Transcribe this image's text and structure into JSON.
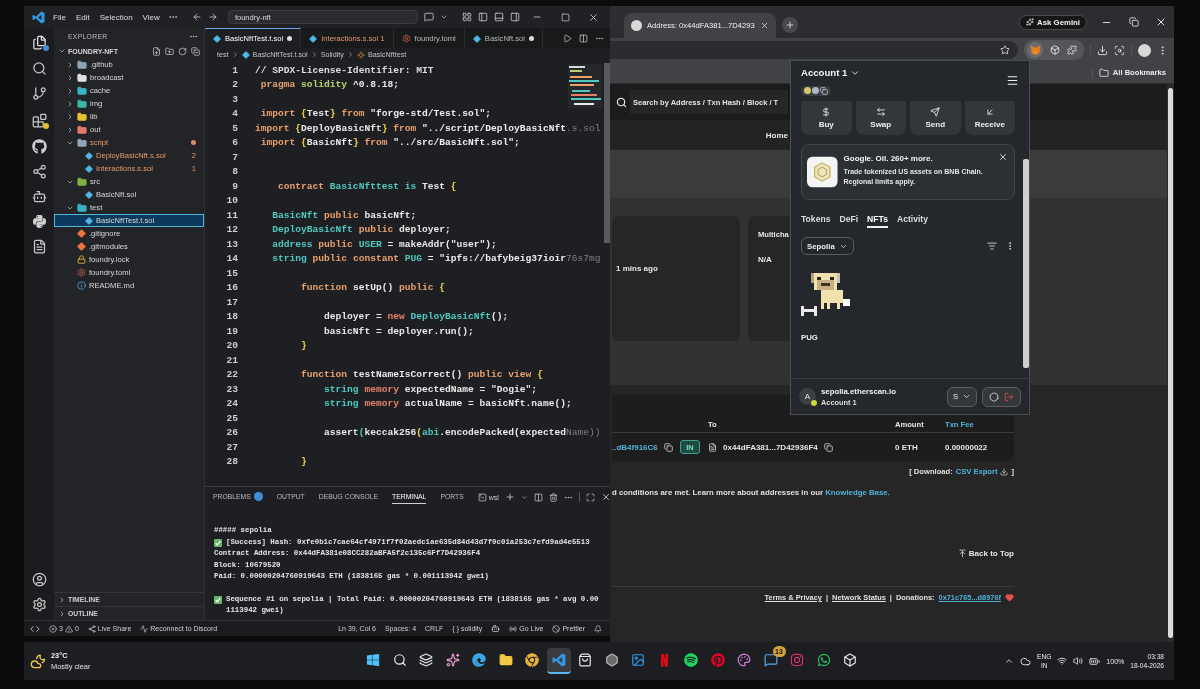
{
  "vscode": {
    "menu": [
      "File",
      "Edit",
      "Selection",
      "View"
    ],
    "command_center": "foundry-nft",
    "explorer_title": "EXPLORER",
    "project": "FOUNDRY-NFT",
    "tree": [
      {
        "name": ".github",
        "kind": "folder",
        "color": "#8fa4b8",
        "expanded": false,
        "selected": false,
        "modified": false
      },
      {
        "name": "broadcast",
        "kind": "folder",
        "color": "#e3e3e3",
        "expanded": false,
        "selected": false,
        "modified": false
      },
      {
        "name": "cache",
        "kind": "folder",
        "color": "#38b2c7",
        "expanded": false,
        "selected": false,
        "modified": false
      },
      {
        "name": "img",
        "kind": "folder",
        "color": "#3bb5a6",
        "expanded": false,
        "selected": false,
        "modified": false
      },
      {
        "name": "lib",
        "kind": "folder",
        "color": "#e8c22d",
        "expanded": false,
        "selected": false,
        "modified": false
      },
      {
        "name": "out",
        "kind": "folder",
        "color": "#e5796b",
        "expanded": false,
        "selected": false,
        "modified": false
      },
      {
        "name": "script",
        "kind": "folder",
        "color": "#8fa4b8",
        "expanded": true,
        "selected": false,
        "modified": true,
        "children": [
          {
            "name": "DeployBasicNft.s.sol",
            "kind": "solidity",
            "selected": false,
            "modified": true,
            "problems": "2"
          },
          {
            "name": "Interactions.s.sol",
            "kind": "solidity",
            "selected": false,
            "modified": true,
            "problems": "1"
          }
        ]
      },
      {
        "name": "src",
        "kind": "folder",
        "color": "#7cb342",
        "expanded": true,
        "selected": false,
        "modified": false,
        "children": [
          {
            "name": "BasicNft.sol",
            "kind": "solidity",
            "selected": false,
            "modified": false
          }
        ]
      },
      {
        "name": "test",
        "kind": "folder",
        "color": "#38b2c7",
        "expanded": true,
        "selected": false,
        "modified": false,
        "children": [
          {
            "name": "BasicNftTest.t.sol",
            "kind": "solidity",
            "selected": true,
            "modified": false
          }
        ]
      },
      {
        "name": ".gitignore",
        "kind": "git",
        "selected": false,
        "modified": false
      },
      {
        "name": ".gitmodules",
        "kind": "git",
        "selected": false,
        "modified": false
      },
      {
        "name": "foundry.lock",
        "kind": "lock",
        "selected": false,
        "modified": false
      },
      {
        "name": "foundry.toml",
        "kind": "toml",
        "selected": false,
        "modified": false
      },
      {
        "name": "README.md",
        "kind": "readme",
        "selected": false,
        "modified": false
      }
    ],
    "sections": [
      {
        "label": "TIMELINE",
        "expanded": false
      },
      {
        "label": "OUTLINE",
        "expanded": false
      }
    ],
    "tabs": [
      {
        "label": "BasicNftTest.t.sol",
        "kind": "solidity",
        "selected": true,
        "dirty": true
      },
      {
        "label": "Interactions.s.sol",
        "kind": "solidity",
        "selected": false,
        "dirty": false,
        "problems": "1"
      },
      {
        "label": "foundry.toml",
        "kind": "toml",
        "selected": false,
        "dirty": false
      },
      {
        "label": "BasicNft.sol",
        "kind": "solidity",
        "selected": false,
        "dirty": true
      }
    ],
    "breadcrumbs": [
      {
        "label": "test",
        "kind": "folder"
      },
      {
        "label": "BasicNftTest.t.sol",
        "kind": "solidity"
      },
      {
        "label": "Solidity",
        "kind": "text"
      },
      {
        "label": "BasicNfttest",
        "kind": "class"
      }
    ],
    "code": [
      {
        "number": "1",
        "tokens": [
          {
            "text": "// SPDX-License-Identifier: MIT",
            "kind": "comment"
          }
        ]
      },
      {
        "number": "2",
        "tokens": [
          {
            "text": " pragma",
            "kind": "keyword"
          },
          {
            "text": " solidity",
            "kind": "builtin"
          },
          {
            "text": " ^0.8.18;",
            "kind": "plain"
          }
        ]
      },
      {
        "number": "3"
      },
      {
        "number": "4",
        "tokens": [
          {
            "text": " import ",
            "kind": "keyword"
          },
          {
            "text": "{",
            "kind": "brace"
          },
          {
            "text": "Test",
            "kind": "plain"
          },
          {
            "text": "}",
            "kind": "brace"
          },
          {
            "text": " from ",
            "kind": "keyword"
          },
          {
            "text": "\"forge-std/Test.sol\";",
            "kind": "string"
          }
        ]
      },
      {
        "number": "5",
        "tokens": [
          {
            "text": "import ",
            "kind": "keyword"
          },
          {
            "text": "{",
            "kind": "brace"
          },
          {
            "text": "DeployBasicNft",
            "kind": "plain"
          },
          {
            "text": "}",
            "kind": "brace"
          },
          {
            "text": " from ",
            "kind": "keyword"
          },
          {
            "text": "\"../script/DeployBasicNft",
            "kind": "string"
          },
          {
            "text": ".s.sol",
            "kind": "ghost"
          }
        ]
      },
      {
        "number": "6",
        "tokens": [
          {
            "text": " import ",
            "kind": "keyword"
          },
          {
            "text": "{",
            "kind": "brace"
          },
          {
            "text": "BasicNft",
            "kind": "plain"
          },
          {
            "text": "}",
            "kind": "brace"
          },
          {
            "text": " from ",
            "kind": "keyword"
          },
          {
            "text": "\"../src/BasicNft.sol\";",
            "kind": "string"
          }
        ]
      },
      {
        "number": "7"
      },
      {
        "number": "8"
      },
      {
        "number": "9",
        "tokens": [
          {
            "text": "    contract ",
            "kind": "keyword"
          },
          {
            "text": "BasicNfttest is ",
            "kind": "type"
          },
          {
            "text": "Test ",
            "kind": "plain"
          },
          {
            "text": "{",
            "kind": "brace"
          }
        ]
      },
      {
        "number": "10"
      },
      {
        "number": "11",
        "tokens": [
          {
            "text": "   BasicNft ",
            "kind": "type"
          },
          {
            "text": "public ",
            "kind": "keyword"
          },
          {
            "text": "basicNft;",
            "kind": "plain"
          }
        ]
      },
      {
        "number": "12",
        "tokens": [
          {
            "text": "   DeployBasicNft ",
            "kind": "type"
          },
          {
            "text": "public ",
            "kind": "keyword"
          },
          {
            "text": "deployer;",
            "kind": "plain"
          }
        ]
      },
      {
        "number": "13",
        "tokens": [
          {
            "text": "   address ",
            "kind": "type"
          },
          {
            "text": "public ",
            "kind": "keyword"
          },
          {
            "text": "USER ",
            "kind": "type"
          },
          {
            "text": "= makeAddr(\"user\");",
            "kind": "plain"
          }
        ]
      },
      {
        "number": "14",
        "tokens": [
          {
            "text": "   string ",
            "kind": "type"
          },
          {
            "text": "public constant ",
            "kind": "keyword"
          },
          {
            "text": "PUG ",
            "kind": "type"
          },
          {
            "text": "= \"ipfs://bafybeig37ioir",
            "kind": "string"
          },
          {
            "text": "76s7mg",
            "kind": "ghost"
          }
        ]
      },
      {
        "number": "15"
      },
      {
        "number": "16",
        "tokens": [
          {
            "text": "        function ",
            "kind": "keyword"
          },
          {
            "text": "setUp() ",
            "kind": "plain"
          },
          {
            "text": "public ",
            "kind": "keyword"
          },
          {
            "text": "{",
            "kind": "brace"
          }
        ]
      },
      {
        "number": "17"
      },
      {
        "number": "18",
        "tokens": [
          {
            "text": "            deployer = ",
            "kind": "plain"
          },
          {
            "text": "new ",
            "kind": "storage"
          },
          {
            "text": "DeployBasicNft",
            "kind": "type"
          },
          {
            "text": "();",
            "kind": "plain"
          }
        ]
      },
      {
        "number": "19",
        "tokens": [
          {
            "text": "            basicNft = deployer.run();",
            "kind": "plain"
          }
        ]
      },
      {
        "number": "20",
        "tokens": [
          {
            "text": "        }",
            "kind": "brace"
          }
        ]
      },
      {
        "number": "21"
      },
      {
        "number": "22",
        "tokens": [
          {
            "text": "        function ",
            "kind": "keyword"
          },
          {
            "text": "testNameIsCorrect() ",
            "kind": "plain"
          },
          {
            "text": "public view ",
            "kind": "keyword"
          },
          {
            "text": "{",
            "kind": "brace"
          }
        ]
      },
      {
        "number": "23",
        "tokens": [
          {
            "text": "            string ",
            "kind": "type"
          },
          {
            "text": "memory ",
            "kind": "storage"
          },
          {
            "text": "expectedName = \"Dogie\";",
            "kind": "plain"
          }
        ]
      },
      {
        "number": "24",
        "tokens": [
          {
            "text": "            string ",
            "kind": "type"
          },
          {
            "text": "memory ",
            "kind": "storage"
          },
          {
            "text": "actualName = basicNft.name();",
            "kind": "plain"
          }
        ]
      },
      {
        "number": "25"
      },
      {
        "number": "26",
        "tokens": [
          {
            "text": "            assert",
            "kind": "plain"
          },
          {
            "text": "(",
            "kind": "type"
          },
          {
            "text": "keccak256",
            "kind": "plain"
          },
          {
            "text": "(",
            "kind": "brace"
          },
          {
            "text": "abi",
            "kind": "type"
          },
          {
            "text": ".encodePacked(expected",
            "kind": "plain"
          },
          {
            "text": "Name))",
            "kind": "ghost"
          }
        ]
      },
      {
        "number": "27"
      },
      {
        "number": "28",
        "tokens": [
          {
            "text": "        }",
            "kind": "brace"
          }
        ]
      }
    ],
    "panel_tabs": [
      {
        "label": "PROBLEMS",
        "selected": false,
        "badge": true
      },
      {
        "label": "OUTPUT",
        "selected": false,
        "badge": false
      },
      {
        "label": "DEBUG CONSOLE",
        "selected": false,
        "badge": false
      },
      {
        "label": "TERMINAL",
        "selected": true,
        "badge": false
      },
      {
        "label": "PORTS",
        "selected": false,
        "badge": false
      }
    ],
    "shell": "wsl",
    "terminal": [
      {
        "lines": [
          {
            "text": "##### sepolia",
            "kind": "plain"
          },
          {
            "text": "[Success] Hash: 0xfe0b1c7cae64cf4971f7f02aedc1ae635d84d43d7f0c01a253c7efd9ad4e5513",
            "kind": "success"
          },
          {
            "text": "Contract Address: 0x44dFA381e08CC282aBFA5f2c135c6Ff7D42936F4",
            "kind": "plain"
          },
          {
            "text": "Block: 10679520",
            "kind": "plain"
          },
          {
            "text": "Paid: 0.00000204760919643 ETH (1838165 gas * 0.001113942 gwei)",
            "kind": "plain"
          }
        ]
      },
      {
        "lines": [
          {
            "text": "Sequence #1 on sepolia | Total Paid: 0.00000204760919643 ETH (1838165 gas * avg 0.001113942 gwei)",
            "kind": "success"
          }
        ]
      }
    ],
    "status_bar": {
      "errors": "3",
      "warnings": "0",
      "left": [
        {
          "label": "Live Share",
          "kind": "liveshare"
        },
        {
          "label": "Reconnect to Discord",
          "kind": "discord"
        }
      ],
      "right": [
        {
          "label": "Ln 39, Col 6",
          "kind": "text"
        },
        {
          "label": "Spaces: 4",
          "kind": "text"
        },
        {
          "label": "CRLF",
          "kind": "text"
        },
        {
          "label": "{ } solidity",
          "kind": "text"
        },
        {
          "kind": "copilot"
        },
        {
          "label": "Go Live",
          "kind": "golive"
        },
        {
          "label": "Prettier",
          "kind": "prettier"
        },
        {
          "kind": "bell"
        }
      ]
    }
  },
  "browser": {
    "tabs": [
      {
        "title": "Address: 0x44dFA381...7D4293",
        "selected": true
      }
    ],
    "ask_button": "Ask Gemini",
    "bookmarks_folder": "All Bookmarks",
    "page": {
      "search_placeholder": "Search by Address / Txn Hash / Block / T",
      "nav": [
        "Home"
      ],
      "cards": [
        {
          "value": "1 mins ago"
        },
        {
          "title": "Multicha",
          "value": "N/A"
        }
      ],
      "table": {
        "columns": [
          {
            "label": "To",
            "kind": "text"
          },
          {
            "label": "Amount",
            "kind": "text"
          },
          {
            "label": "Txn Fee",
            "kind": "link"
          }
        ],
        "rows": [
          {
            "from": "..dB4f916C6",
            "direction": "IN",
            "to": "0x44dFA381...7D42936F4",
            "amount": "0 ETH",
            "fee": "0.00000022"
          }
        ]
      },
      "download": {
        "prefix": "[ Download:",
        "link": "CSV Export",
        "suffix": "]"
      },
      "notice": {
        "text": "d conditions are met. Learn more about addresses in our",
        "link": "Knowledge Base."
      },
      "back_to_top": "Back to Top",
      "footer": [
        {
          "text": "Terms & Privacy",
          "kind": "link"
        },
        {
          "text": "|",
          "kind": "separator"
        },
        {
          "text": "Network Status",
          "kind": "link"
        },
        {
          "text": "|",
          "kind": "separator"
        },
        {
          "text": "Donations:",
          "kind": "label"
        },
        {
          "text": "0x71c765...d8976f",
          "kind": "address"
        },
        {
          "kind": "heart"
        }
      ]
    },
    "wallet": {
      "account": "Account 1",
      "actions": [
        {
          "label": "Buy",
          "kind": "buy"
        },
        {
          "label": "Swap",
          "kind": "swap"
        },
        {
          "label": "Send",
          "kind": "send"
        },
        {
          "label": "Receive",
          "kind": "receive"
        }
      ],
      "banner": {
        "title": "Google. Oil. 260+ more.",
        "text": "Trade tokenized US assets on BNB Chain. Regional limits apply."
      },
      "tabs": [
        {
          "label": "Tokens",
          "selected": false
        },
        {
          "label": "DeFi",
          "selected": false
        },
        {
          "label": "NFTs",
          "selected": true
        },
        {
          "label": "Activity",
          "selected": false
        }
      ],
      "network": "Sepolia",
      "nfts": [
        {
          "name": "PUG"
        }
      ],
      "connection": {
        "avatar": "A",
        "site": "sepolia.etherscan.io",
        "account": "Account 1",
        "network": "S",
        "connected": true
      }
    }
  },
  "taskbar": {
    "weather": {
      "temperature": "23°C",
      "condition": "Mostly clear"
    },
    "apps": [
      {
        "kind": "start",
        "active": false
      },
      {
        "kind": "search",
        "active": false
      },
      {
        "kind": "taskview",
        "active": false
      },
      {
        "kind": "copilot",
        "active": false
      },
      {
        "kind": "edge",
        "active": false
      },
      {
        "kind": "files",
        "active": false
      },
      {
        "kind": "chrome",
        "active": false
      },
      {
        "kind": "vscode",
        "active": true
      },
      {
        "kind": "store",
        "active": false
      },
      {
        "kind": "hexagon",
        "active": false
      },
      {
        "kind": "board",
        "active": false
      },
      {
        "kind": "netflix",
        "active": false
      },
      {
        "kind": "spotify",
        "active": false
      },
      {
        "kind": "pinterest",
        "active": false
      },
      {
        "kind": "paint",
        "active": false
      },
      {
        "kind": "chat",
        "active": false,
        "badge": "13"
      },
      {
        "kind": "instagram",
        "active": false
      },
      {
        "kind": "whatsapp",
        "active": false
      },
      {
        "kind": "cube",
        "active": false
      }
    ],
    "tray": {
      "language": "ENG",
      "region": "IN",
      "battery": "100%",
      "time": "03:38",
      "date": "18-04-2026"
    }
  }
}
